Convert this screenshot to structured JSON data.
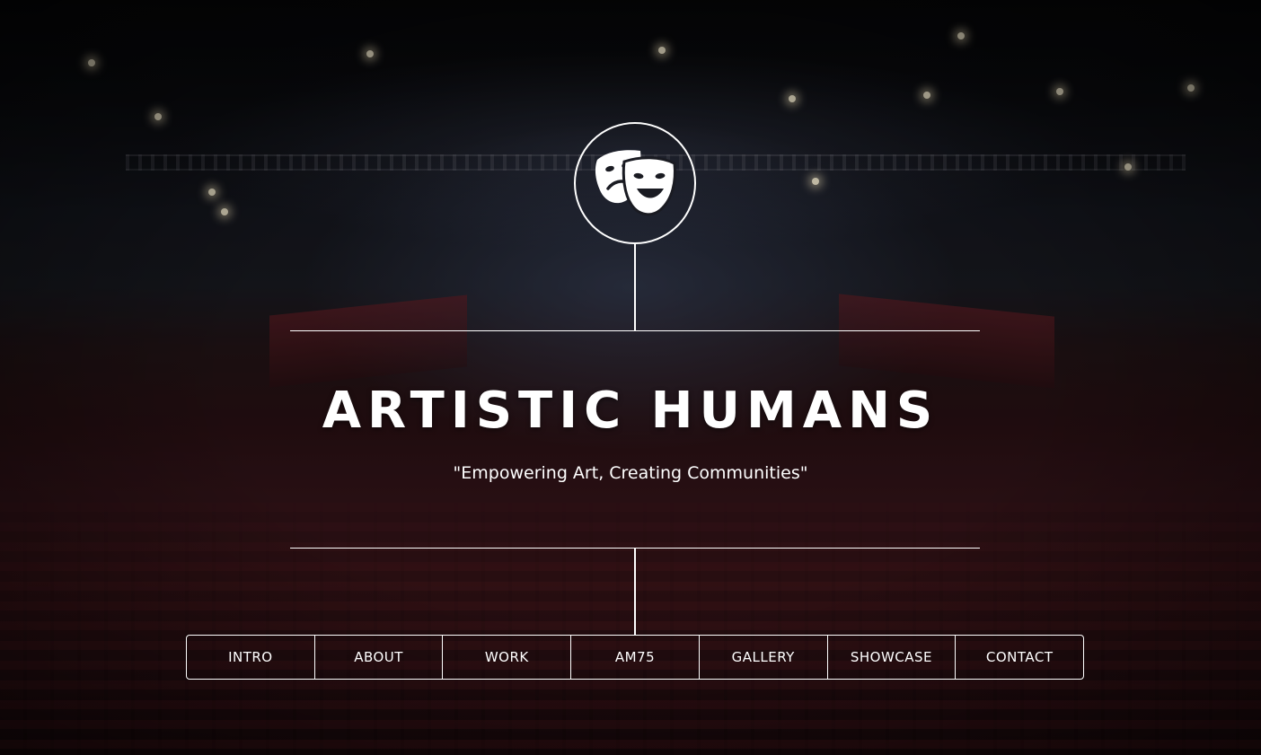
{
  "site": {
    "logo_icon": "theater-masks-icon",
    "title": "Artistic Humans",
    "tagline": "\"Empowering Art, Creating Communities\""
  },
  "nav": {
    "items": [
      {
        "label": "INTRO"
      },
      {
        "label": "ABOUT"
      },
      {
        "label": "WORK"
      },
      {
        "label": "AM75"
      },
      {
        "label": "GALLERY"
      },
      {
        "label": "SHOWCASE"
      },
      {
        "label": "CONTACT"
      }
    ]
  },
  "colors": {
    "text": "#ffffff",
    "lines": "#ffffff",
    "background": "#0b0c10",
    "seat_red": "#3a1519"
  }
}
